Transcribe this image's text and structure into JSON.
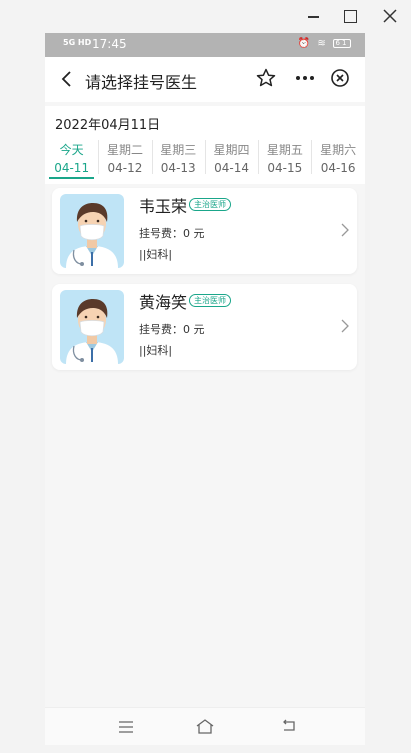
{
  "status_bar": {
    "signal": "5G HD",
    "time": "17:45",
    "battery": "61"
  },
  "navbar": {
    "title": "请选择挂号医生"
  },
  "date": {
    "current": "2022年04月11日",
    "days": [
      {
        "weekday": "今天",
        "date": "04-11",
        "active": true
      },
      {
        "weekday": "星期二",
        "date": "04-12"
      },
      {
        "weekday": "星期三",
        "date": "04-13"
      },
      {
        "weekday": "星期四",
        "date": "04-14"
      },
      {
        "weekday": "星期五",
        "date": "04-15"
      },
      {
        "weekday": "星期六",
        "date": "04-16"
      }
    ]
  },
  "doctors": [
    {
      "name": "韦玉荣",
      "title": "主治医师",
      "fee": "挂号费：0 元",
      "dept": "||妇科|"
    },
    {
      "name": "黄海笑",
      "title": "主治医师",
      "fee": "挂号费：0 元",
      "dept": "||妇科|"
    }
  ],
  "colors": {
    "accent": "#1aa68a",
    "avatar_bg": "#bfe4f6"
  }
}
